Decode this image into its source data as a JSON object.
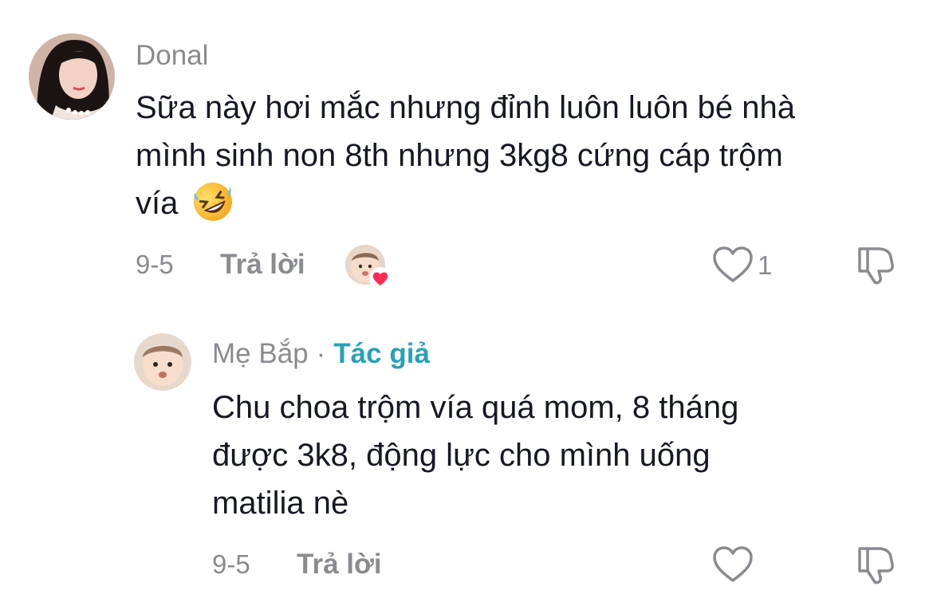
{
  "comments": [
    {
      "username": "Donal",
      "text": "Sữa này hơi mắc nhưng đỉnh luôn luôn bé nhà mình sinh non 8th nhưng 3kg8 cứng cáp trộm vía",
      "text_lines": [
        "Sữa này hơi mắc nhưng đỉnh luôn luôn bé nhà",
        "mình sinh non 8th nhưng 3kg8 cứng cáp trộm",
        "vía"
      ],
      "emoji": "rolling-on-floor-laughing",
      "date": "9-5",
      "reply_label": "Trả lời",
      "like_count": "1",
      "liked_by_creator": true
    },
    {
      "username": "Mẹ Bắp",
      "separator": "·",
      "author_tag": "Tác giả",
      "text_lines": [
        "Chu choa trộm vía quá mom, 8 tháng",
        "được 3k8, động lực cho mình uống",
        "matilia nè"
      ],
      "date": "9-5",
      "reply_label": "Trả lời",
      "like_count": ""
    }
  ],
  "colors": {
    "text": "#161823",
    "muted": "#8a8b91",
    "author_tag": "#2aa0b8",
    "heart_badge": "#fe2c55"
  },
  "icons": [
    "heart-outline-icon",
    "dislike-icon",
    "heart-badge-icon",
    "emoji-laughing-icon"
  ]
}
